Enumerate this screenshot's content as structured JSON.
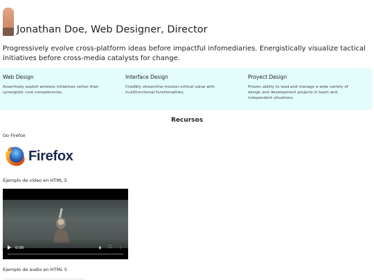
{
  "header": {
    "title": "Jonathan Doe, Web Designer, Director"
  },
  "intro": {
    "text": "Progressively evolve cross-platform ideas before impactful infomediaries. Energistically visualize tactical initiatives before cross-media catalysts for change."
  },
  "services": [
    {
      "title": "Web Design",
      "description": "Assertively exploit wireless initiatives rather than synergistic core competencies."
    },
    {
      "title": "Interface Design",
      "description": "Credibly streamline mission-critical value with multifunctional functionalities."
    },
    {
      "title": "Proyect Design",
      "description": "Proven ability to lead and manage a wide variety of design and development projects in team and independent situations."
    }
  ],
  "resources": {
    "section_title": "Recursos",
    "firefox_label": "Go Firefox",
    "firefox_wordmark": "Firefox",
    "video_label": "Ejemplo de vídeo en HTML 5",
    "audio_label": "Ejemplo de audio en HTML 5"
  },
  "video_player": {
    "time": "0:00",
    "progress": 0,
    "icons": [
      "play-icon",
      "volume-icon",
      "fullscreen-icon",
      "more-options-icon"
    ]
  },
  "colors": {
    "services_background": "#e3fcfc",
    "text": "#1f1f1f",
    "firefox_wordmark": "#1a2a4f"
  }
}
